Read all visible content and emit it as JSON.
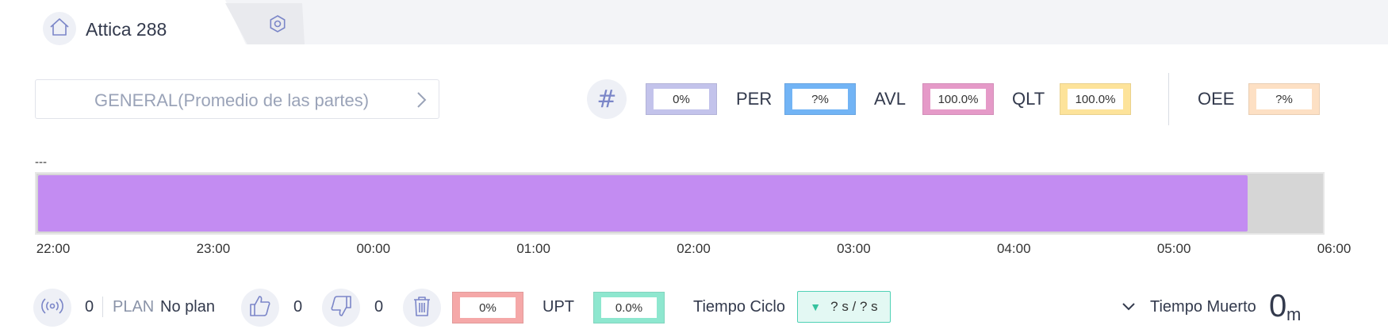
{
  "header": {
    "title": "Attica 288",
    "icons": {
      "home": "home-icon",
      "settings": "gear-icon"
    }
  },
  "selector": {
    "label": "GENERAL(Promedio de las partes)",
    "icon": "chevron-right-icon"
  },
  "metrics": {
    "count_icon": "#",
    "count_value": "0%",
    "per_label": "PER",
    "per_value": "?%",
    "avl_label": "AVL",
    "avl_value": "100.0%",
    "qlt_label": "QLT",
    "qlt_value": "100.0%",
    "oee_label": "OEE",
    "oee_value": "?%",
    "colors": {
      "count": "#c3c3eb",
      "per": "#72b4f5",
      "avl": "#e59ac8",
      "qlt": "#fde39a",
      "oee": "#fde0c4"
    }
  },
  "timeline": {
    "label": "---",
    "progress": 0.94,
    "fill_color": "#c38cf2",
    "ticks": [
      "22:00",
      "23:00",
      "00:00",
      "01:00",
      "02:00",
      "03:00",
      "04:00",
      "05:00",
      "06:00"
    ]
  },
  "bottom": {
    "signal_icon": "signal-icon",
    "count": "0",
    "plan_label": "PLAN",
    "plan_value": "No plan",
    "thumbs_up_icon": "thumbs-up-icon",
    "good_count": "0",
    "thumbs_down_icon": "thumbs-down-icon",
    "bad_count": "0",
    "trash_icon": "trash-icon",
    "scrap_pct": "0%",
    "scrap_color": "#f5a8a8",
    "upt_label": "UPT",
    "upt_value": "0.0%",
    "upt_color": "#8ee7cf",
    "cycle_label": "Tiempo Ciclo",
    "cycle_arrow": "▼",
    "cycle_value": "? s / ? s",
    "dead_label": "Tiempo Muerto",
    "dead_value": "0",
    "dead_unit": "m"
  }
}
